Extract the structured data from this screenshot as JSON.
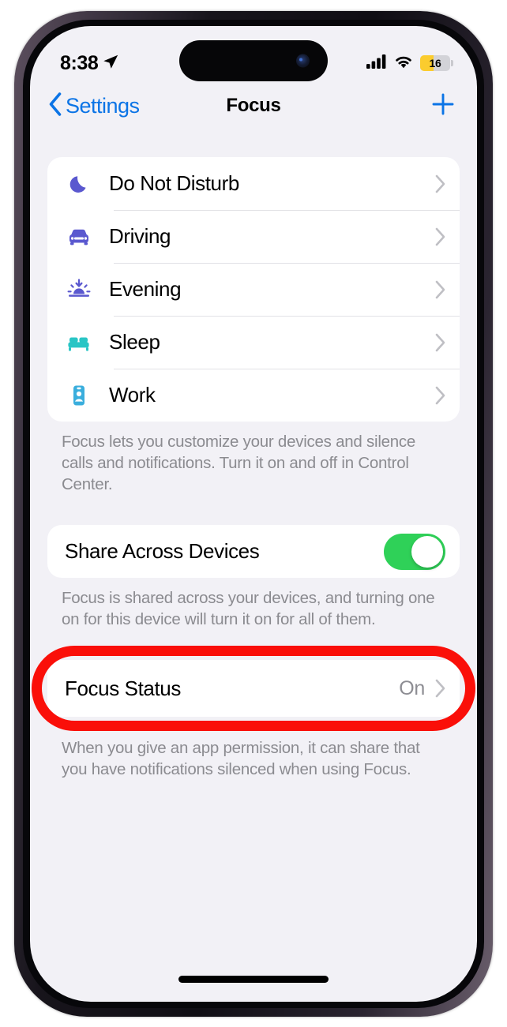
{
  "status_bar": {
    "time": "8:38",
    "location_icon": "location-arrow-icon",
    "cellular_icon": "cellular-signal-icon",
    "wifi_icon": "wifi-icon",
    "battery_percent": "16",
    "battery_color": "#fbcc2e"
  },
  "nav": {
    "back_label": "Settings",
    "back_icon": "chevron-left-icon",
    "title": "Focus",
    "add_icon": "plus-icon"
  },
  "focus_list": {
    "items": [
      {
        "label": "Do Not Disturb",
        "icon": "moon-icon",
        "color": "#5a58cf"
      },
      {
        "label": "Driving",
        "icon": "car-icon",
        "color": "#5a58cf"
      },
      {
        "label": "Evening",
        "icon": "sunset-icon",
        "color": "#5a58cf"
      },
      {
        "label": "Sleep",
        "icon": "bed-icon",
        "color": "#29c5c5"
      },
      {
        "label": "Work",
        "icon": "id-badge-icon",
        "color": "#3aaedd"
      }
    ],
    "footer": "Focus lets you customize your devices and silence calls and notifications. Turn it on and off in Control Center."
  },
  "share_section": {
    "label": "Share Across Devices",
    "toggle_state": "on",
    "toggle_color": "#2fd158",
    "footer": "Focus is shared across your devices, and turning one on for this device will turn it on for all of them."
  },
  "focus_status_section": {
    "label": "Focus Status",
    "value": "On",
    "footer": "When you give an app permission, it can share that you have notifications silenced when using Focus.",
    "highlight_color": "#fa0f09"
  }
}
